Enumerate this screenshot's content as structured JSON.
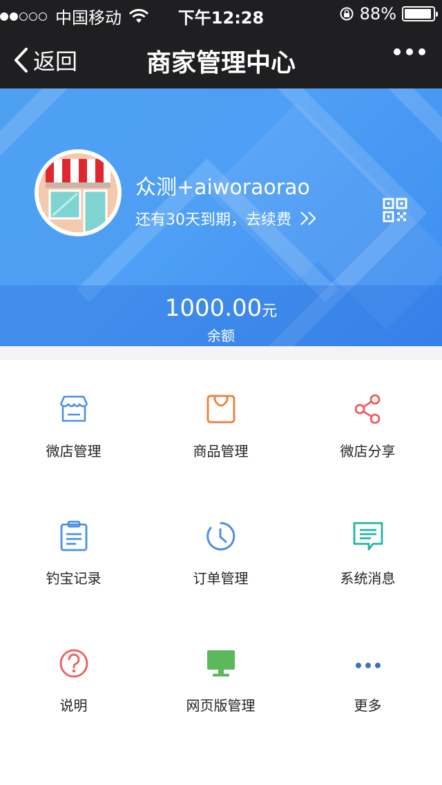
{
  "status_bar": {
    "carrier": "中国移动",
    "time": "下午12:28",
    "battery": "88%"
  },
  "nav": {
    "back_label": "返回",
    "title": "商家管理中心"
  },
  "profile": {
    "shop_name": "众测+aiworaorao",
    "expire_text": "还有30天到期，去续费",
    "balance_amount": "1000.00",
    "balance_unit": "元",
    "balance_label": "余额"
  },
  "colors": {
    "nav_bg": "#1f1f22",
    "hero_blue": "#4da0f2",
    "icon_blue": "#4a90e2",
    "icon_orange": "#f07c3a",
    "icon_red": "#f05a5a",
    "icon_teal": "#1fb5a0",
    "icon_green": "#5cb85c"
  },
  "menu": [
    {
      "label": "微店管理",
      "icon": "storefront-icon"
    },
    {
      "label": "商品管理",
      "icon": "shopping-bag-icon"
    },
    {
      "label": "微店分享",
      "icon": "share-icon"
    },
    {
      "label": "钓宝记录",
      "icon": "clipboard-icon"
    },
    {
      "label": "订单管理",
      "icon": "clock-icon"
    },
    {
      "label": "系统消息",
      "icon": "message-icon"
    },
    {
      "label": "说明",
      "icon": "help-icon"
    },
    {
      "label": "网页版管理",
      "icon": "monitor-icon"
    },
    {
      "label": "更多",
      "icon": "more-icon"
    }
  ]
}
